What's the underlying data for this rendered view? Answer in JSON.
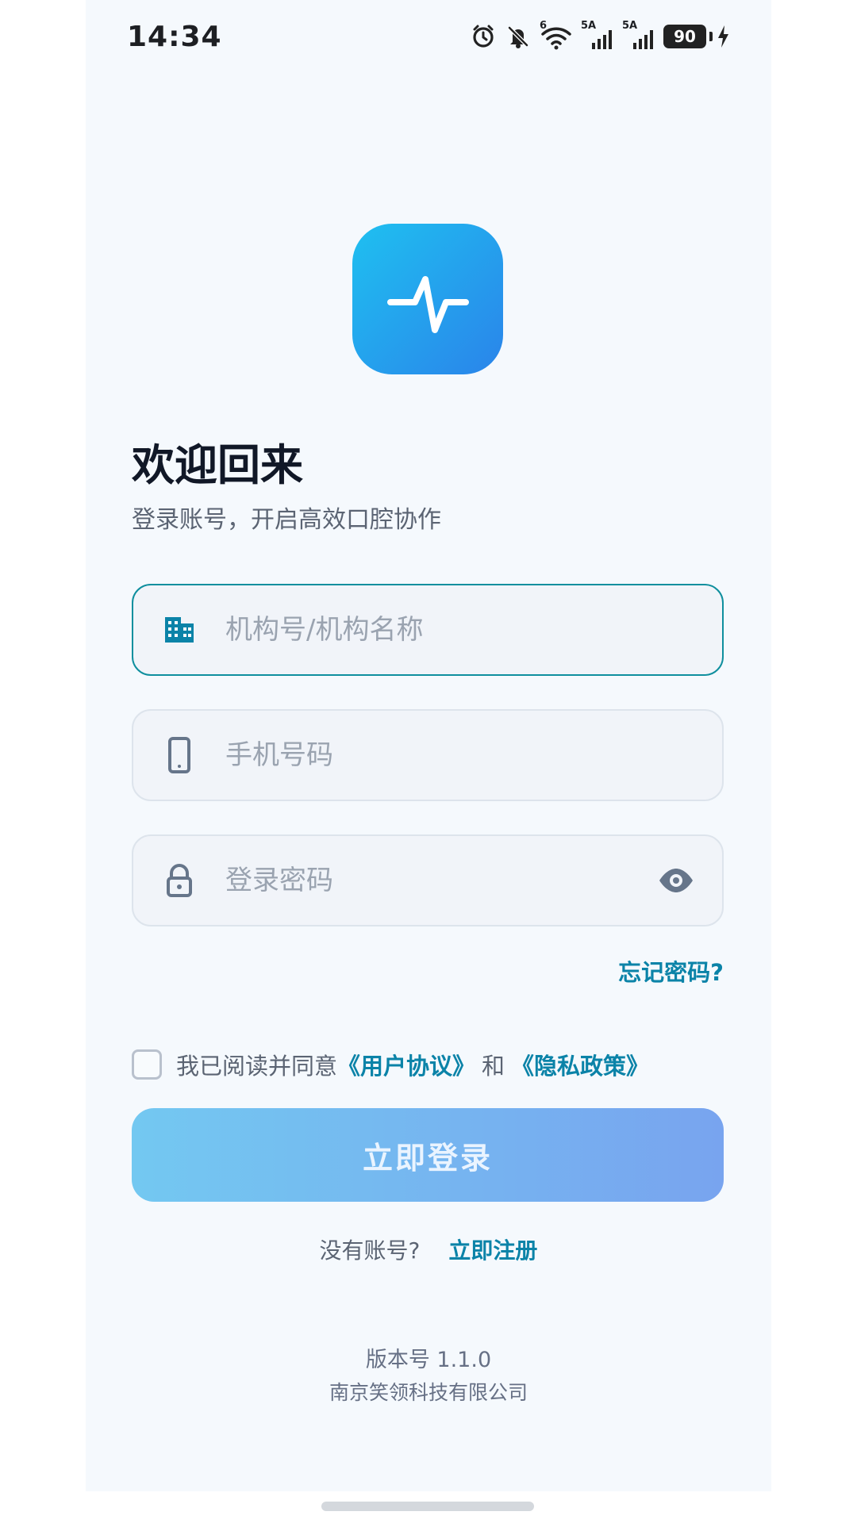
{
  "status_bar": {
    "time": "14:34",
    "wifi_badge": "6",
    "signal_1_label": "5A",
    "signal_2_label": "5A",
    "battery": "90"
  },
  "header": {
    "title": "欢迎回来",
    "subtitle": "登录账号，开启高效口腔协作"
  },
  "form": {
    "institution_placeholder": "机构号/机构名称",
    "phone_placeholder": "手机号码",
    "password_placeholder": "登录密码",
    "forgot_password": "忘记密码?"
  },
  "agreement": {
    "prefix": "我已阅读并同意",
    "user_agreement": "《用户协议》",
    "and": "和",
    "privacy_policy": "《隐私政策》"
  },
  "actions": {
    "login": "立即登录",
    "no_account": "没有账号?",
    "register": "立即注册"
  },
  "footer": {
    "version": "版本号 1.1.0",
    "company": "南京笑领科技有限公司"
  },
  "colors": {
    "accent": "#0b83a8",
    "brand_gradient_start": "#1fc0f0",
    "brand_gradient_end": "#2a84ea"
  },
  "icons": {
    "logo": "pulse-line-icon",
    "institution": "building-icon",
    "phone": "mobile-phone-icon",
    "password": "lock-icon",
    "visibility": "eye-icon"
  }
}
